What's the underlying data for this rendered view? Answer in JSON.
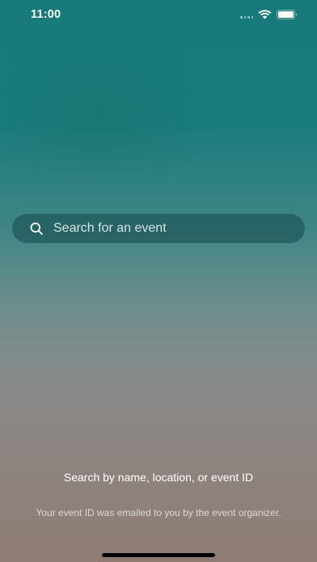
{
  "status_bar": {
    "time": "11:00",
    "icons": [
      "signal-dots-icon",
      "wifi-icon",
      "battery-icon"
    ]
  },
  "search": {
    "placeholder": "Search for an event",
    "value": "",
    "icon": "search-icon"
  },
  "hint": {
    "title": "Search by name, location, or event ID",
    "subtitle": "Your event ID was emailed to you by the event organizer."
  },
  "colors": {
    "top_teal": "#177a7a",
    "bottom_mauve": "#8f7d74",
    "search_bg": "#14484a",
    "home_indicator": "#000000"
  }
}
